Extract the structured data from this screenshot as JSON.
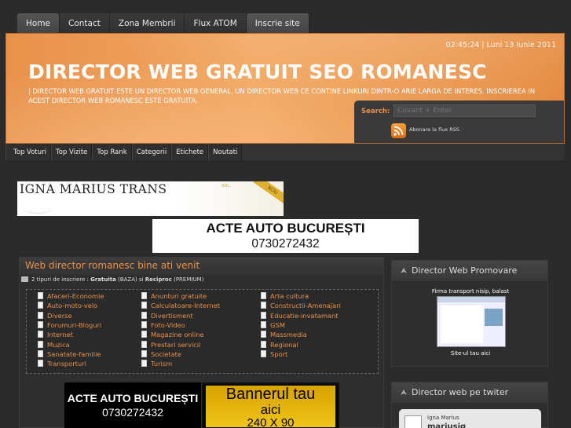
{
  "top_nav": [
    "Home",
    "Contact",
    "Zona Membrii",
    "Flux ATOM",
    "Inscrie site"
  ],
  "header": {
    "datetime": "02:45:24 | Luni 13 Iunie 2011",
    "title": "DIRECTOR WEB GRATUIT SEO ROMANESC",
    "description": "| DIRECTOR WEB GRATUIT ESTE UN DIRECTOR WEB GENERAL, UN DIRECTOR WEB CE CONTINE LINKURI DINTR-O ARIE LARGA DE INTERES. INSCRIEREA IN ACEST DIRECTOR WEB ROMANESC ESTE GRATUITA.",
    "search_label": "Search:",
    "search_placeholder": "Cuvant + Enter",
    "rss_text": "Abonare la flux RSS"
  },
  "sub_nav": [
    "Top Voturi",
    "Top Vizite",
    "Top Rank",
    "Categorii",
    "Etichete",
    "Noutati"
  ],
  "banners": {
    "banner1_title": "IGNA MARIUS TRANS",
    "banner1_srl": "SRL",
    "banner1_ribbon": "NOU",
    "banner2_line1": "ACTE AUTO BUCUREȘTI",
    "banner2_line2": "0730272432"
  },
  "main": {
    "title": "Web director romanesc bine ati venit",
    "intro_prefix": "2 tipuri de inscriere : ",
    "intro_gratuita": "Gratuita",
    "intro_mid": " (BAZA) si ",
    "intro_reciproc": "Reciproc",
    "intro_suffix": " (PREMIUM)",
    "categories": [
      [
        "Afaceri-Economie",
        "Auto-moto-velo",
        "Diverse",
        "Forumuri-Bloguri",
        "Internet",
        "Muzica",
        "Sanatate-familie",
        "Transporturi"
      ],
      [
        "Anunturi gratuite",
        "Calculatoare-Internet",
        "Divertisment",
        "Foto-Video",
        "Magazine online",
        "Prestari servicii",
        "Societate",
        "Turism"
      ],
      [
        "Arta cultura",
        "Constructii-Amenajari",
        "Educatie-invatamant",
        "GSM",
        "Massmedia",
        "Regional",
        "Sport"
      ]
    ],
    "ad1_line1": "ACTE AUTO BUCUREȘTI",
    "ad1_line2": "0730272432",
    "ad2_line1": "Bannerul tau",
    "ad2_line2": "aici",
    "ad2_line3": "240 X 90"
  },
  "side1": {
    "title": "Director Web Promovare",
    "firma": "Firma transport nisip, balast",
    "site_ul": "Site-ul tau aici"
  },
  "side2": {
    "title": "Director web pe twiter",
    "name": "Igna Marius",
    "handle": "mariusig"
  },
  "colors": {
    "accent": "#e8914b",
    "background": "#2b2b2b",
    "header": "#f2a763"
  }
}
